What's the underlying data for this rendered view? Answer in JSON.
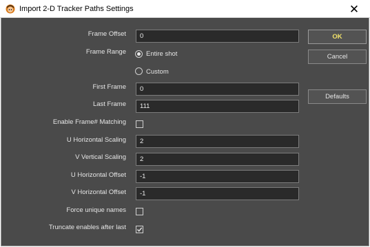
{
  "window": {
    "title": "Import 2-D Tracker Paths Settings",
    "close_glyph": "✕"
  },
  "form": {
    "frame_offset": {
      "label": "Frame Offset",
      "value": "0"
    },
    "frame_range": {
      "label": "Frame Range",
      "options": [
        {
          "label": "Entire shot",
          "selected": true
        },
        {
          "label": "Custom",
          "selected": false
        }
      ]
    },
    "first_frame": {
      "label": "First Frame",
      "value": "0"
    },
    "last_frame": {
      "label": "Last Frame",
      "value": "111"
    },
    "enable_frame_matching": {
      "label": "Enable Frame# Matching",
      "checked": false
    },
    "u_horizontal_scaling": {
      "label": "U Horizontal Scaling",
      "value": "2"
    },
    "v_vertical_scaling": {
      "label": "V Vertical Scaling",
      "value": "2"
    },
    "u_horizontal_offset": {
      "label": "U Horizontal Offset",
      "value": "-1"
    },
    "v_horizontal_offset": {
      "label": "V Horizontal Offset",
      "value": "-1"
    },
    "force_unique_names": {
      "label": "Force unique names",
      "checked": false
    },
    "truncate_enables": {
      "label": "Truncate enables after last",
      "checked": true
    }
  },
  "buttons": {
    "ok": "OK",
    "cancel": "Cancel",
    "defaults": "Defaults"
  },
  "colors": {
    "panel_bg": "#4a4a4a",
    "field_bg": "#2a2a2a",
    "ok_text": "#f2e36a"
  }
}
